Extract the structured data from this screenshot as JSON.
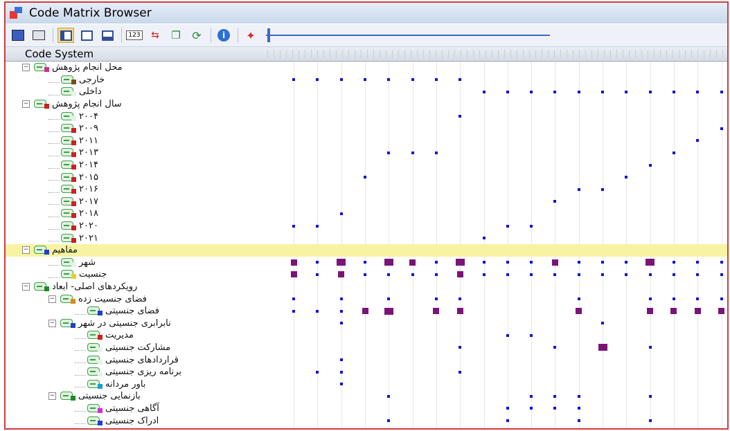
{
  "window": {
    "title": "Code Matrix Browser"
  },
  "toolbar": {
    "buttons": [
      "export-icon",
      "print-icon",
      "layout-left-icon",
      "layout-single-icon",
      "layout-bottom-icon",
      "numbers-icon",
      "arrows-icon",
      "copy-icon",
      "refresh-icon",
      "info-icon",
      "run-icon"
    ],
    "numbers_label": "123"
  },
  "header": {
    "code_system_label": "Code System"
  },
  "colors": {
    "small_mark": "#1212d8",
    "large_mark": "#7a1478",
    "highlight": "#f7f3a3"
  },
  "tree": [
    {
      "label": "محل انجام پژوهش",
      "depth": 0,
      "expander": "−",
      "swatch": "#d0308c",
      "marks": []
    },
    {
      "label": "خارجی",
      "depth": 1,
      "expander": "",
      "swatch": "#7a4a18",
      "marks": [
        [
          0,
          1
        ],
        [
          1,
          1
        ],
        [
          2,
          1
        ],
        [
          3,
          1
        ],
        [
          4,
          1
        ],
        [
          5,
          1
        ],
        [
          6,
          1
        ],
        [
          7,
          1
        ]
      ]
    },
    {
      "label": "داخلی",
      "depth": 1,
      "expander": "",
      "swatch": "#e8f4e6",
      "marks": [
        [
          8,
          1
        ],
        [
          9,
          1
        ],
        [
          10,
          1
        ],
        [
          11,
          1
        ],
        [
          12,
          1
        ],
        [
          13,
          1
        ],
        [
          14,
          1
        ],
        [
          15,
          1
        ],
        [
          16,
          1
        ],
        [
          17,
          1
        ],
        [
          18,
          1
        ]
      ]
    },
    {
      "label": "سال انجام پژوهش",
      "depth": 0,
      "expander": "−",
      "swatch": "#d02020",
      "marks": []
    },
    {
      "label": "۲۰۰۴",
      "depth": 1,
      "expander": "",
      "swatch": "#e8f4e6",
      "marks": [
        [
          7,
          1
        ]
      ]
    },
    {
      "label": "۲۰۰۹",
      "depth": 1,
      "expander": "",
      "swatch": "#d02020",
      "marks": [
        [
          18,
          1
        ]
      ]
    },
    {
      "label": "۲۰۱۱",
      "depth": 1,
      "expander": "",
      "swatch": "#d02020",
      "marks": [
        [
          17,
          1
        ]
      ]
    },
    {
      "label": "۲۰۱۳",
      "depth": 1,
      "expander": "",
      "swatch": "#d02020",
      "marks": [
        [
          4,
          1
        ],
        [
          5,
          1
        ],
        [
          6,
          1
        ],
        [
          16,
          1
        ]
      ]
    },
    {
      "label": "۲۰۱۴",
      "depth": 1,
      "expander": "",
      "swatch": "#d02020",
      "marks": [
        [
          15,
          1
        ]
      ]
    },
    {
      "label": "۲۰۱۵",
      "depth": 1,
      "expander": "",
      "swatch": "#d02020",
      "marks": [
        [
          3,
          1
        ],
        [
          14,
          1
        ]
      ]
    },
    {
      "label": "۲۰۱۶",
      "depth": 1,
      "expander": "",
      "swatch": "#d02020",
      "marks": [
        [
          12,
          1
        ],
        [
          13,
          1
        ]
      ]
    },
    {
      "label": "۲۰۱۷",
      "depth": 1,
      "expander": "",
      "swatch": "#d02020",
      "marks": [
        [
          11,
          1
        ]
      ]
    },
    {
      "label": "۲۰۱۸",
      "depth": 1,
      "expander": "",
      "swatch": "#d02020",
      "marks": [
        [
          2,
          1
        ]
      ]
    },
    {
      "label": "۲۰۲۰",
      "depth": 1,
      "expander": "",
      "swatch": "#d02020",
      "marks": [
        [
          0,
          1
        ],
        [
          1,
          1
        ],
        [
          9,
          1
        ],
        [
          10,
          1
        ]
      ]
    },
    {
      "label": "۲۰۲۱",
      "depth": 1,
      "expander": "",
      "swatch": "#d02020",
      "marks": [
        [
          8,
          1
        ]
      ]
    },
    {
      "label": "مفاهیم",
      "depth": 0,
      "expander": "−",
      "swatch": "#1f3fd0",
      "highlight": true,
      "marks": []
    },
    {
      "label": "شهر",
      "depth": 1,
      "expander": "",
      "swatch": "#e8f4e6",
      "marks": [
        [
          0,
          2
        ],
        [
          1,
          1
        ],
        [
          2,
          3
        ],
        [
          3,
          1
        ],
        [
          4,
          3
        ],
        [
          5,
          2
        ],
        [
          6,
          1
        ],
        [
          7,
          3
        ],
        [
          8,
          1
        ],
        [
          9,
          1
        ],
        [
          10,
          1
        ],
        [
          11,
          2
        ],
        [
          12,
          1
        ],
        [
          13,
          1
        ],
        [
          14,
          1
        ],
        [
          15,
          3
        ],
        [
          16,
          1
        ],
        [
          17,
          1
        ],
        [
          18,
          1
        ]
      ]
    },
    {
      "label": "جنسیت",
      "depth": 1,
      "expander": "",
      "swatch": "#e8d020",
      "marks": [
        [
          0,
          2
        ],
        [
          1,
          1
        ],
        [
          2,
          2
        ],
        [
          3,
          1
        ],
        [
          4,
          1
        ],
        [
          5,
          1
        ],
        [
          6,
          1
        ],
        [
          7,
          2
        ],
        [
          8,
          1
        ],
        [
          9,
          1
        ],
        [
          10,
          1
        ],
        [
          11,
          1
        ],
        [
          12,
          1
        ],
        [
          13,
          1
        ],
        [
          14,
          1
        ],
        [
          15,
          1
        ],
        [
          16,
          1
        ],
        [
          17,
          1
        ],
        [
          18,
          1
        ]
      ]
    },
    {
      "label": "رویکردهای اصلی- ابعاد",
      "depth": 0,
      "expander": "−",
      "swatch": "#1e8a2a",
      "marks": []
    },
    {
      "label": "فضای جنسیت زده",
      "depth": 1,
      "expander": "−",
      "swatch": "#e08a10",
      "marks": [
        [
          0,
          1
        ],
        [
          2,
          1
        ],
        [
          4,
          1
        ],
        [
          6,
          1
        ],
        [
          7,
          1
        ],
        [
          12,
          1
        ],
        [
          15,
          1
        ],
        [
          16,
          1
        ],
        [
          17,
          1
        ],
        [
          18,
          1
        ]
      ]
    },
    {
      "label": "فضای جنسیتی",
      "depth": 2,
      "expander": "",
      "swatch": "#1f3fd0",
      "marks": [
        [
          0,
          1
        ],
        [
          1,
          1
        ],
        [
          2,
          1
        ],
        [
          3,
          2
        ],
        [
          4,
          3
        ],
        [
          6,
          2
        ],
        [
          7,
          2
        ],
        [
          12,
          2
        ],
        [
          15,
          2
        ],
        [
          16,
          2
        ],
        [
          17,
          2
        ],
        [
          18,
          2
        ]
      ]
    },
    {
      "label": "نابرابری جنسیتی در شهر",
      "depth": 1,
      "expander": "−",
      "swatch": "#1f3fd0",
      "marks": [
        [
          2,
          1
        ],
        [
          13,
          1
        ]
      ]
    },
    {
      "label": "مدیریت",
      "depth": 2,
      "expander": "",
      "swatch": "#d02020",
      "marks": [
        [
          9,
          1
        ],
        [
          10,
          1
        ]
      ]
    },
    {
      "label": "مشارکت جنسیتی",
      "depth": 2,
      "expander": "",
      "swatch": "#e8f4e6",
      "marks": [
        [
          7,
          1
        ],
        [
          11,
          1
        ],
        [
          13,
          3
        ],
        [
          15,
          1
        ]
      ]
    },
    {
      "label": "قراردادهای جنسیتی",
      "depth": 2,
      "expander": "",
      "swatch": "#e8f4e6",
      "marks": [
        [
          2,
          1
        ]
      ]
    },
    {
      "label": "برنامه ریزی جنسیتی",
      "depth": 2,
      "expander": "",
      "swatch": "#e8f4e6",
      "marks": [
        [
          1,
          1
        ],
        [
          2,
          1
        ],
        [
          7,
          1
        ]
      ]
    },
    {
      "label": "باور مردانه",
      "depth": 2,
      "expander": "",
      "swatch": "#1a9ed0",
      "marks": [
        [
          2,
          1
        ]
      ]
    },
    {
      "label": "بازنمایی جنسیتی",
      "depth": 1,
      "expander": "−",
      "swatch": "#1e8a2a",
      "marks": [
        [
          4,
          1
        ],
        [
          10,
          1
        ],
        [
          11,
          1
        ],
        [
          12,
          1
        ],
        [
          15,
          1
        ]
      ]
    },
    {
      "label": "آگاهی جنسیتی",
      "depth": 2,
      "expander": "",
      "swatch": "#d030d0",
      "marks": [
        [
          9,
          1
        ],
        [
          10,
          1
        ],
        [
          11,
          1
        ],
        [
          12,
          1
        ]
      ]
    },
    {
      "label": "ادراک جنسیتی",
      "depth": 2,
      "expander": "",
      "swatch": "#1f3fd0",
      "marks": [
        [
          4,
          1
        ],
        [
          9,
          1
        ],
        [
          12,
          1
        ],
        [
          15,
          1
        ]
      ]
    }
  ]
}
